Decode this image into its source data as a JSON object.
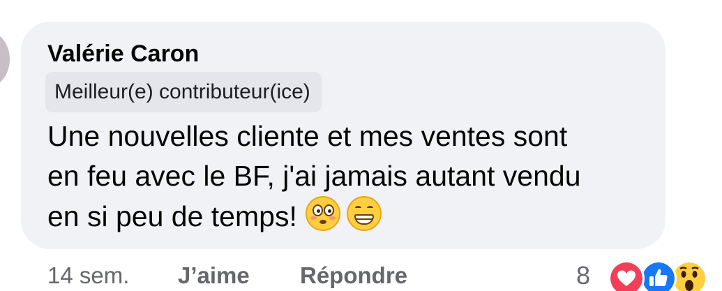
{
  "comment": {
    "author": "Valérie Caron",
    "badge": "Meilleur(e) contributeur(ice)",
    "text_line1": "Une nouvelles cliente et mes ventes sont",
    "text_line2": "en feu avec le BF, j'ai jamais autant vendu",
    "text_line3": "en si peu de temps!",
    "emojis": [
      "flushed-face",
      "grinning-face"
    ]
  },
  "actions": {
    "time": "14 sem.",
    "like_label": "J’aime",
    "reply_label": "Répondre"
  },
  "reactions": {
    "count": "8",
    "types": [
      "love",
      "like",
      "wow"
    ]
  },
  "colors": {
    "bubble": "#f0f2f5",
    "badge": "#e4e6eb",
    "secondary_text": "#65676b",
    "love": "#f33e58",
    "like": "#1877f2",
    "wow": "#ffcf3f"
  }
}
